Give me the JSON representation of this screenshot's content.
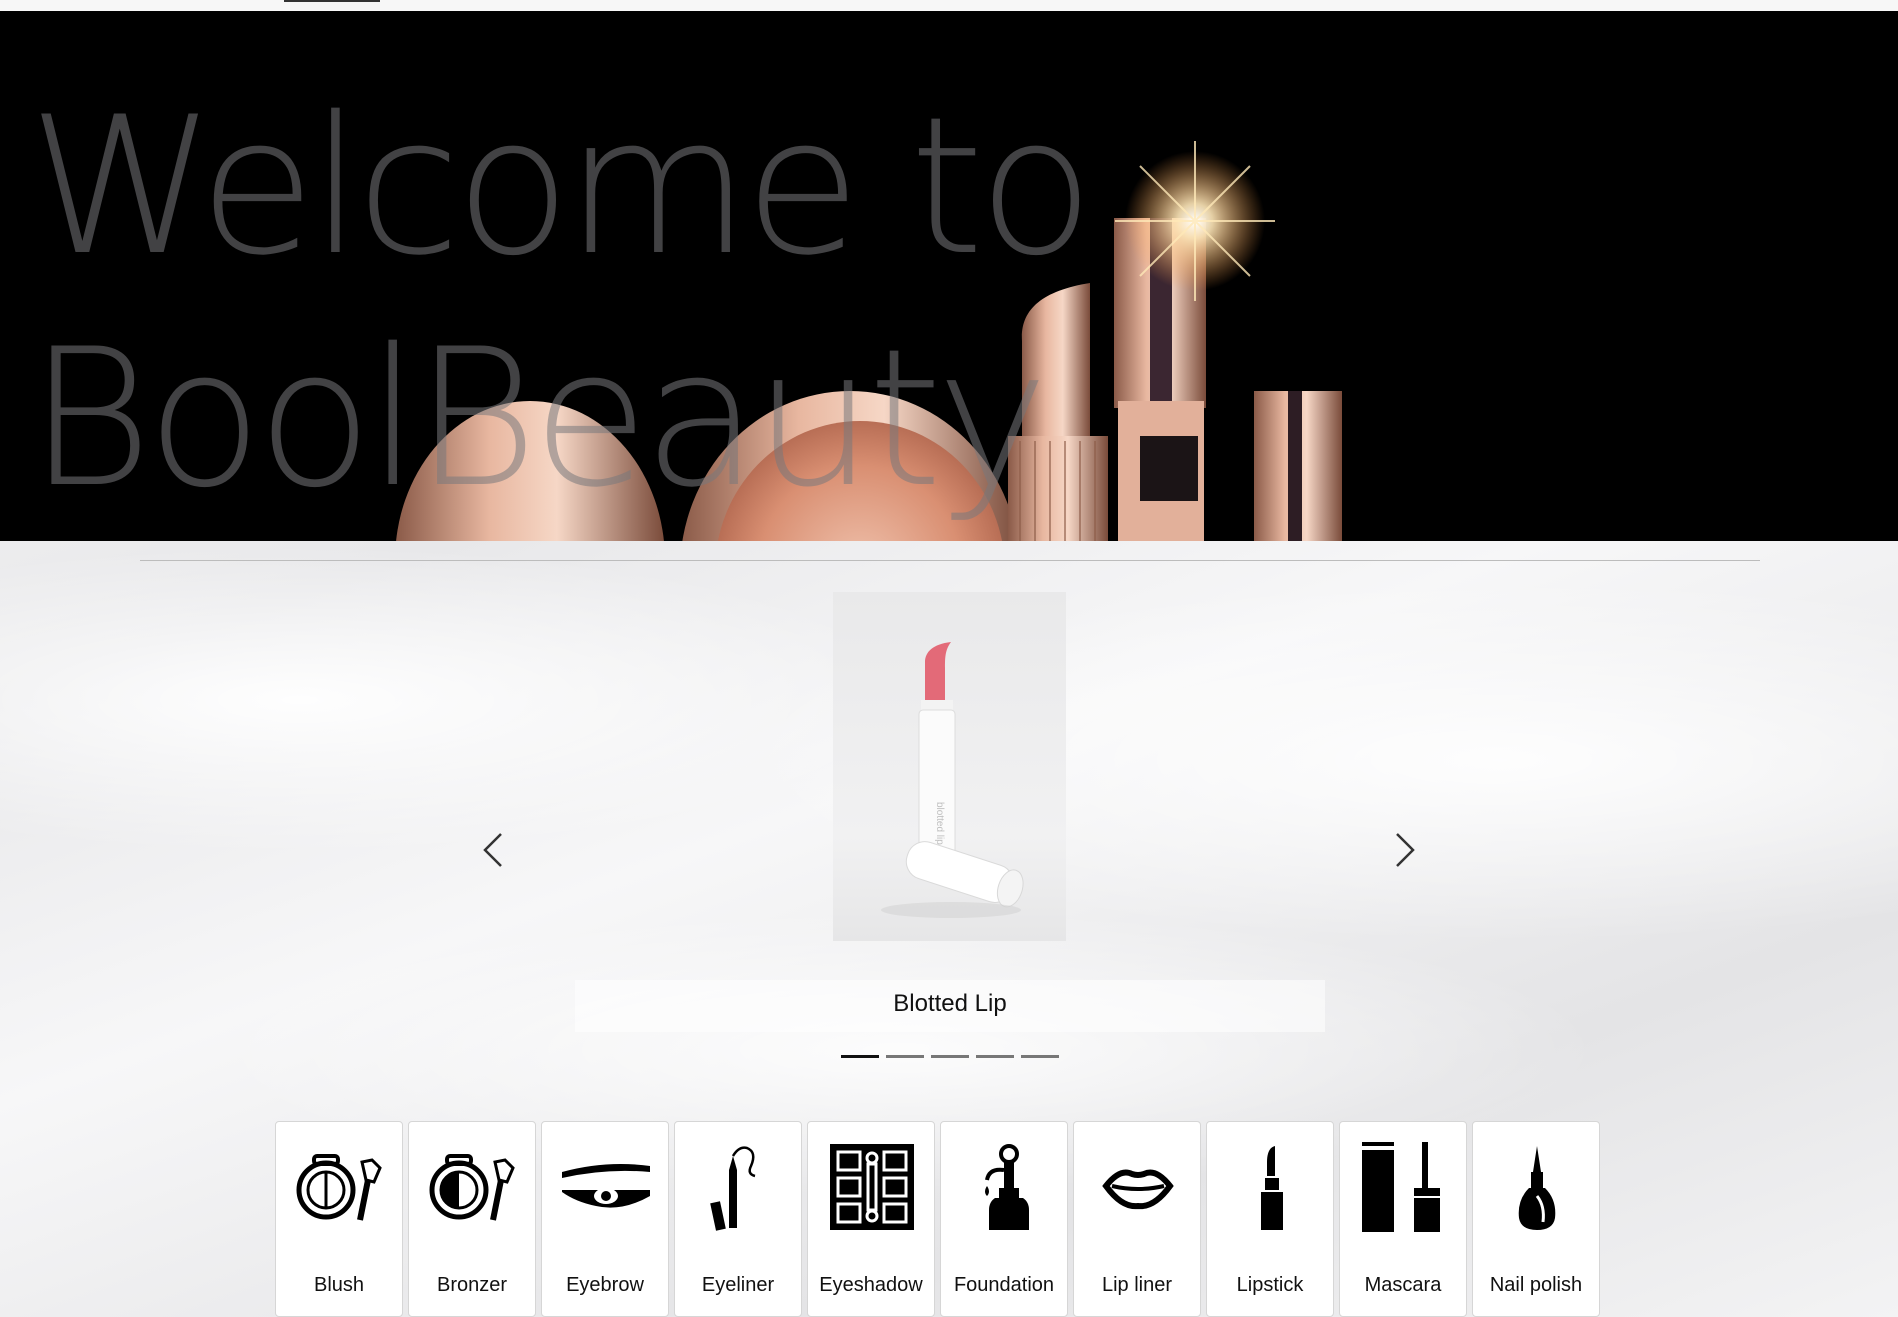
{
  "hero": {
    "title_line1": "Welcome to",
    "title_line2": "BoolBeauty"
  },
  "carousel": {
    "current_slide": "Blotted Lip",
    "slide_count": 5,
    "active_index": 0
  },
  "categories": [
    {
      "label": "Blush",
      "icon": "blush-compact-icon"
    },
    {
      "label": "Bronzer",
      "icon": "bronzer-compact-icon"
    },
    {
      "label": "Eyebrow",
      "icon": "eyebrow-icon"
    },
    {
      "label": "Eyeliner",
      "icon": "eyeliner-pencil-icon"
    },
    {
      "label": "Eyeshadow",
      "icon": "eyeshadow-palette-icon"
    },
    {
      "label": "Foundation",
      "icon": "foundation-bottle-icon"
    },
    {
      "label": "Lip liner",
      "icon": "lips-icon"
    },
    {
      "label": "Lipstick",
      "icon": "lipstick-icon"
    },
    {
      "label": "Mascara",
      "icon": "mascara-icon"
    },
    {
      "label": "Nail polish",
      "icon": "nail-polish-icon"
    }
  ]
}
